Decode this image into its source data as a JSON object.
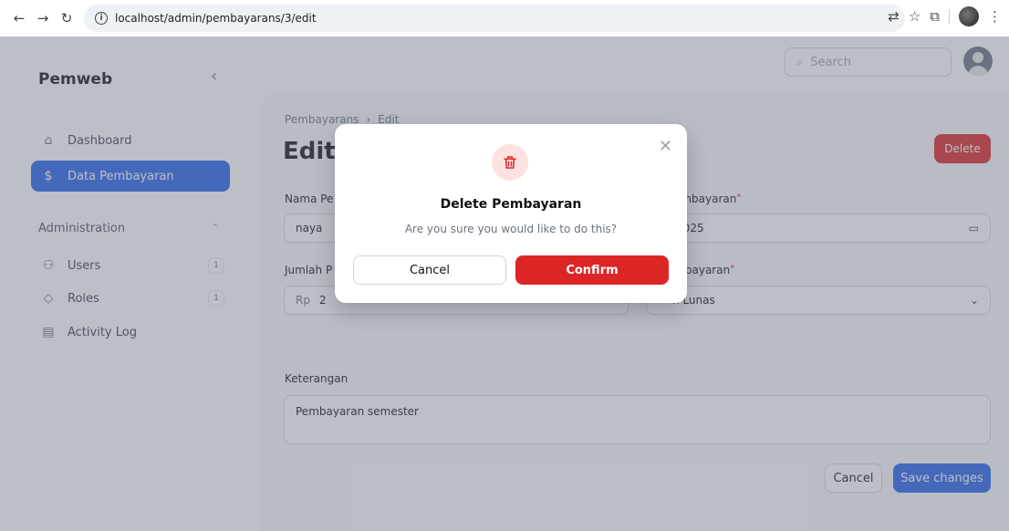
{
  "browser": {
    "url": "localhost/admin/pembayarans/3/edit"
  },
  "app": {
    "brand": "Pemweb",
    "search_placeholder": "Search",
    "accent_color": "#2563eb",
    "danger_color": "#dc2626"
  },
  "sidebar": {
    "items": [
      {
        "label": "Dashboard",
        "icon": "home-icon"
      },
      {
        "label": "Data Pembayaran",
        "icon": "dollar-icon"
      }
    ],
    "group_label": "Administration",
    "group_items": [
      {
        "label": "Users",
        "icon": "users-icon",
        "badge": "1"
      },
      {
        "label": "Roles",
        "icon": "shield-check-icon",
        "badge": "1"
      },
      {
        "label": "Activity Log",
        "icon": "clipboard-icon"
      }
    ]
  },
  "main": {
    "breadcrumb": [
      "Pembayarans",
      "Edit"
    ],
    "title": "Edit",
    "delete_label": "Delete",
    "fields": {
      "nama_label": "Nama Pe",
      "nama_value": "naya",
      "tanggal_label": "l Pembayaran",
      "tanggal_value": "/2025",
      "jumlah_label": "Jumlah P",
      "jumlah_prefix": "Rp",
      "jumlah_value": "2",
      "status_label": "Pembayaran",
      "status_value": "n Lunas",
      "keterangan_label": "Keterangan",
      "keterangan_value": "Pembayaran semester"
    },
    "cancel_label": "Cancel",
    "save_label": "Save changes"
  },
  "modal": {
    "title": "Delete Pembayaran",
    "text": "Are you sure you would like to do this?",
    "cancel_label": "Cancel",
    "confirm_label": "Confirm"
  }
}
